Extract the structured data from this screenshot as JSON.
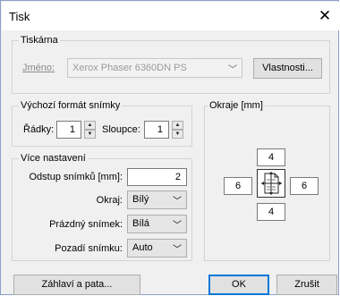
{
  "window": {
    "title": "Tisk",
    "close_icon": "close-icon"
  },
  "printer": {
    "group_label": "Tiskárna",
    "name_label": "Jméno:",
    "name_value": "Xerox Phaser 6360DN PS",
    "properties_button": "Vlastnosti..."
  },
  "format": {
    "group_label": "Výchozí formát snímky",
    "rows_label": "Řádky:",
    "rows_value": "1",
    "cols_label": "Sloupce:",
    "cols_value": "1"
  },
  "more": {
    "group_label": "Více nastavení",
    "spacing_label": "Odstup snímků [mm]:",
    "spacing_value": "2",
    "border_label": "Okraj:",
    "border_value": "Bílý",
    "blank_label": "Prázdný snímek:",
    "blank_value": "Bílá",
    "bg_label": "Pozadí snímku:",
    "bg_value": "Auto"
  },
  "margins": {
    "group_label": "Okraje [mm]",
    "top": "4",
    "left": "6",
    "right": "6",
    "bottom": "4"
  },
  "buttons": {
    "header_footer": "Záhlaví a pata...",
    "ok": "OK",
    "cancel": "Zrušit"
  }
}
